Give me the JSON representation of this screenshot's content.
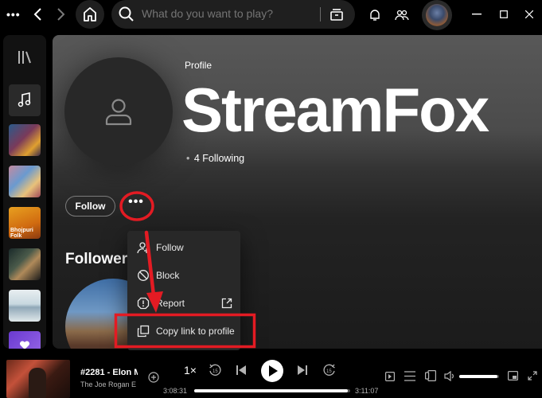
{
  "search": {
    "placeholder": "What do you want to play?"
  },
  "profile": {
    "kicker": "Profile",
    "name": "StreamFox",
    "following": "4 Following",
    "follow_label": "Follow",
    "more_label": "•••"
  },
  "sections": {
    "followers_title": "Follower"
  },
  "context_menu": {
    "items": [
      {
        "label": "Follow",
        "icon": "add-user-icon"
      },
      {
        "label": "Block",
        "icon": "block-icon"
      },
      {
        "label": "Report",
        "icon": "report-icon",
        "trailing_icon": "external-link-icon"
      },
      {
        "label": "Copy link to profile",
        "icon": "copy-icon"
      }
    ]
  },
  "now_playing": {
    "title": "#2281 - Elon M",
    "artist": "The Joe Rogan E",
    "speed": "1×",
    "elapsed": "3:08:31",
    "duration": "3:11:07",
    "progress": 0.985,
    "volume": 0.95
  },
  "sidebar": {
    "items": [
      {
        "name": "sidebar-liked-songs",
        "icon": "music-note-icon"
      },
      {
        "name": "sidebar-playlist-1",
        "label": ""
      },
      {
        "name": "sidebar-playlist-2",
        "label": ""
      },
      {
        "name": "sidebar-playlist-bhojpuri",
        "label": "Bhojpuri Folk"
      },
      {
        "name": "sidebar-playlist-4",
        "label": ""
      },
      {
        "name": "sidebar-playlist-5",
        "label": ""
      },
      {
        "name": "sidebar-playlist-6",
        "label": ""
      }
    ]
  },
  "colors": {
    "accent_red": "#e31b23",
    "background": "#121212",
    "menu_bg": "#282828"
  }
}
